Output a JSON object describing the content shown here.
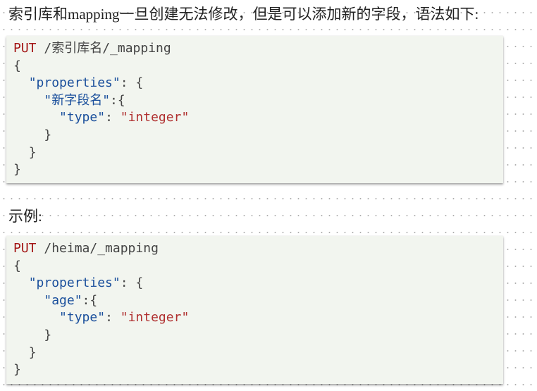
{
  "doc": {
    "intro_text": "索引库和mapping一旦创建无法修改，但是可以添加新的字段，语法如下:",
    "example_heading": "示例:",
    "code_syntax": {
      "method": "PUT",
      "path": " /索引库名/_mapping",
      "open_brace": "{",
      "properties_key": "\"properties\"",
      "properties_sep": ": {",
      "field_key": "\"新字段名\"",
      "field_sep": ":{",
      "type_key": "\"type\"",
      "type_sep": ": ",
      "type_value": "\"integer\"",
      "close_inner": "}",
      "close_props": "}",
      "close_root": "}"
    },
    "code_example": {
      "method": "PUT",
      "path": " /heima/_mapping",
      "open_brace": "{",
      "properties_key": "\"properties\"",
      "properties_sep": ": {",
      "field_key": "\"age\"",
      "field_sep": ":{",
      "type_key": "\"type\"",
      "type_sep": ": ",
      "type_value": "\"integer\"",
      "close_inner": "}",
      "close_props": "}",
      "close_root": "}"
    }
  }
}
